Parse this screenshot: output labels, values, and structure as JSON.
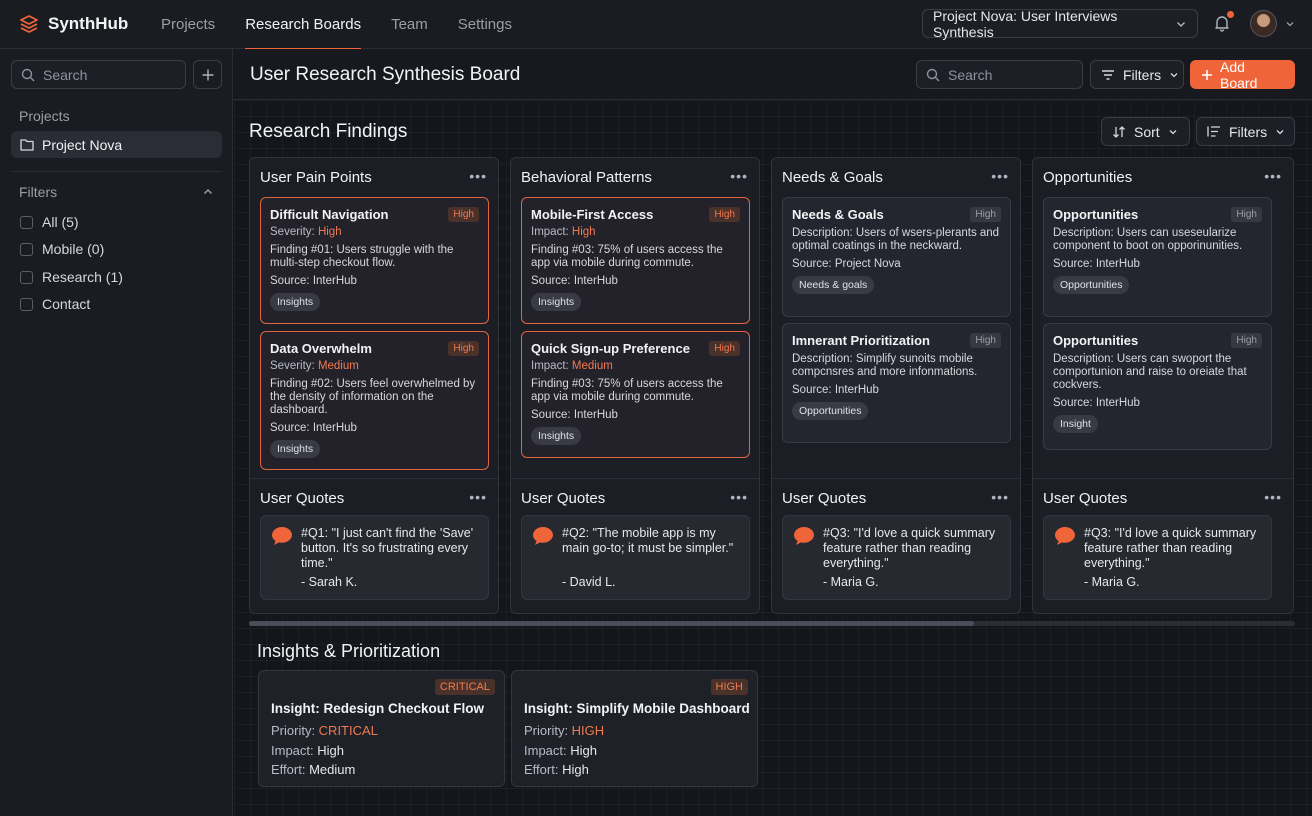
{
  "app": {
    "name": "SynthHub"
  },
  "nav": {
    "tabs": [
      "Projects",
      "Research Boards",
      "Team",
      "Settings"
    ],
    "active": "Research Boards"
  },
  "project_select": {
    "value": "Project Nova: User Interviews Synthesis"
  },
  "sidebar": {
    "search_placeholder": "Search",
    "projects_label": "Projects",
    "active_project": "Project Nova",
    "filters_label": "Filters",
    "filters": [
      "All (5)",
      "Mobile (0)",
      "Research (1)",
      "Contact"
    ]
  },
  "header": {
    "title": "User Research Synthesis Board",
    "search_placeholder": "Search",
    "filters_label": "Filters",
    "add_label": "Add Board"
  },
  "findings": {
    "title": "Research Findings",
    "sort_label": "Sort",
    "filters_label": "Filters"
  },
  "columns": [
    {
      "title": "User Pain Points",
      "cards": [
        {
          "title": "Difficult Navigation",
          "badge": "High",
          "meta_label": "Severity: ",
          "meta_value": "High",
          "desc": "Finding #01: Users struggle with the multi-step checkout flow.",
          "source": "Source: InterHub",
          "tag": "Insights"
        },
        {
          "title": "Data Overwhelm",
          "badge": "High",
          "meta_label": "Severity: ",
          "meta_value": "Medium",
          "desc": "Finding #02: Users feel overwhelmed by the density of information on the dashboard.",
          "source": "Source: InterHub",
          "tag": "Insights"
        }
      ],
      "quote_title": "User Quotes",
      "quote": "#Q1: \"I just can't find the 'Save' button. It's so frustrating every time.\"",
      "quote_author": "- Sarah K."
    },
    {
      "title": "Behavioral Patterns",
      "cards": [
        {
          "title": "Mobile-First Access",
          "badge": "High",
          "meta_label": "Impact: ",
          "meta_value": "High",
          "desc": "Finding #03: 75% of users access the app via mobile during commute.",
          "source": "Source: InterHub",
          "tag": "Insights"
        },
        {
          "title": "Quick Sign-up Preference",
          "badge": "High",
          "meta_label": "Impact: ",
          "meta_value": "Medium",
          "desc": "Finding #03: 75% of users access the app via mobile during commute.",
          "source": "Source: InterHub",
          "tag": "Insights"
        }
      ],
      "quote_title": "User Quotes",
      "quote": "#Q2: \"The mobile app is my main go-to; it must be simpler.\"",
      "quote_author": "- David L."
    },
    {
      "title": "Needs & Goals",
      "cards": [
        {
          "title": "Needs & Goals",
          "badge": "High",
          "desc": "Description: Users of wsers-plerants and optimal coatings in the neckward.",
          "source": "Source: Project Nova",
          "tag": "Needs & goals"
        },
        {
          "title": "Imnerant Prioritization",
          "badge": "High",
          "desc": "Description: Simplify sunoits mobile compcnsres and more infonmations.",
          "source": "Source: InterHub",
          "tag": "Opportunities"
        }
      ],
      "quote_title": "User Quotes",
      "quote": "#Q3: \"I'd love a quick summary feature rather than reading everything.\"",
      "quote_author": "- Maria G."
    },
    {
      "title": "Opportunities",
      "cards": [
        {
          "title": "Opportunities",
          "badge": "High",
          "desc": "Description: Users can useseularize component to boot on opporinunities.",
          "source": "Source: InterHub",
          "tag": "Opportunities"
        },
        {
          "title": "Opportunities",
          "badge": "High",
          "desc": "Description: Users can swoport the comportunion and raise to oreiate that cockvers.",
          "source": "Source: InterHub",
          "tag": "Insight"
        }
      ],
      "quote_title": "User Quotes",
      "quote": "#Q3: \"I'd love a quick summary feature rather than reading everything.\"",
      "quote_author": "- Maria G."
    }
  ],
  "insights": {
    "title": "Insights & Prioritization",
    "items": [
      {
        "badge": "CRITICAL",
        "title": "Insight: Redesign Checkout Flow",
        "priority_label": "Priority: ",
        "priority": "CRITICAL",
        "impact_label": "Impact: ",
        "impact": "High",
        "effort_label": "Effort: ",
        "effort": "Medium"
      },
      {
        "badge": "HIGH",
        "title": "Insight: Simplify Mobile Dashboard",
        "priority_label": "Priority: ",
        "priority": "HIGH",
        "impact_label": "Impact: ",
        "impact": "High",
        "effort_label": "Effort: ",
        "effort": "High"
      }
    ]
  },
  "colors": {
    "accent": "#f0643a",
    "background": "#14161c",
    "surface": "#1c1e25"
  }
}
